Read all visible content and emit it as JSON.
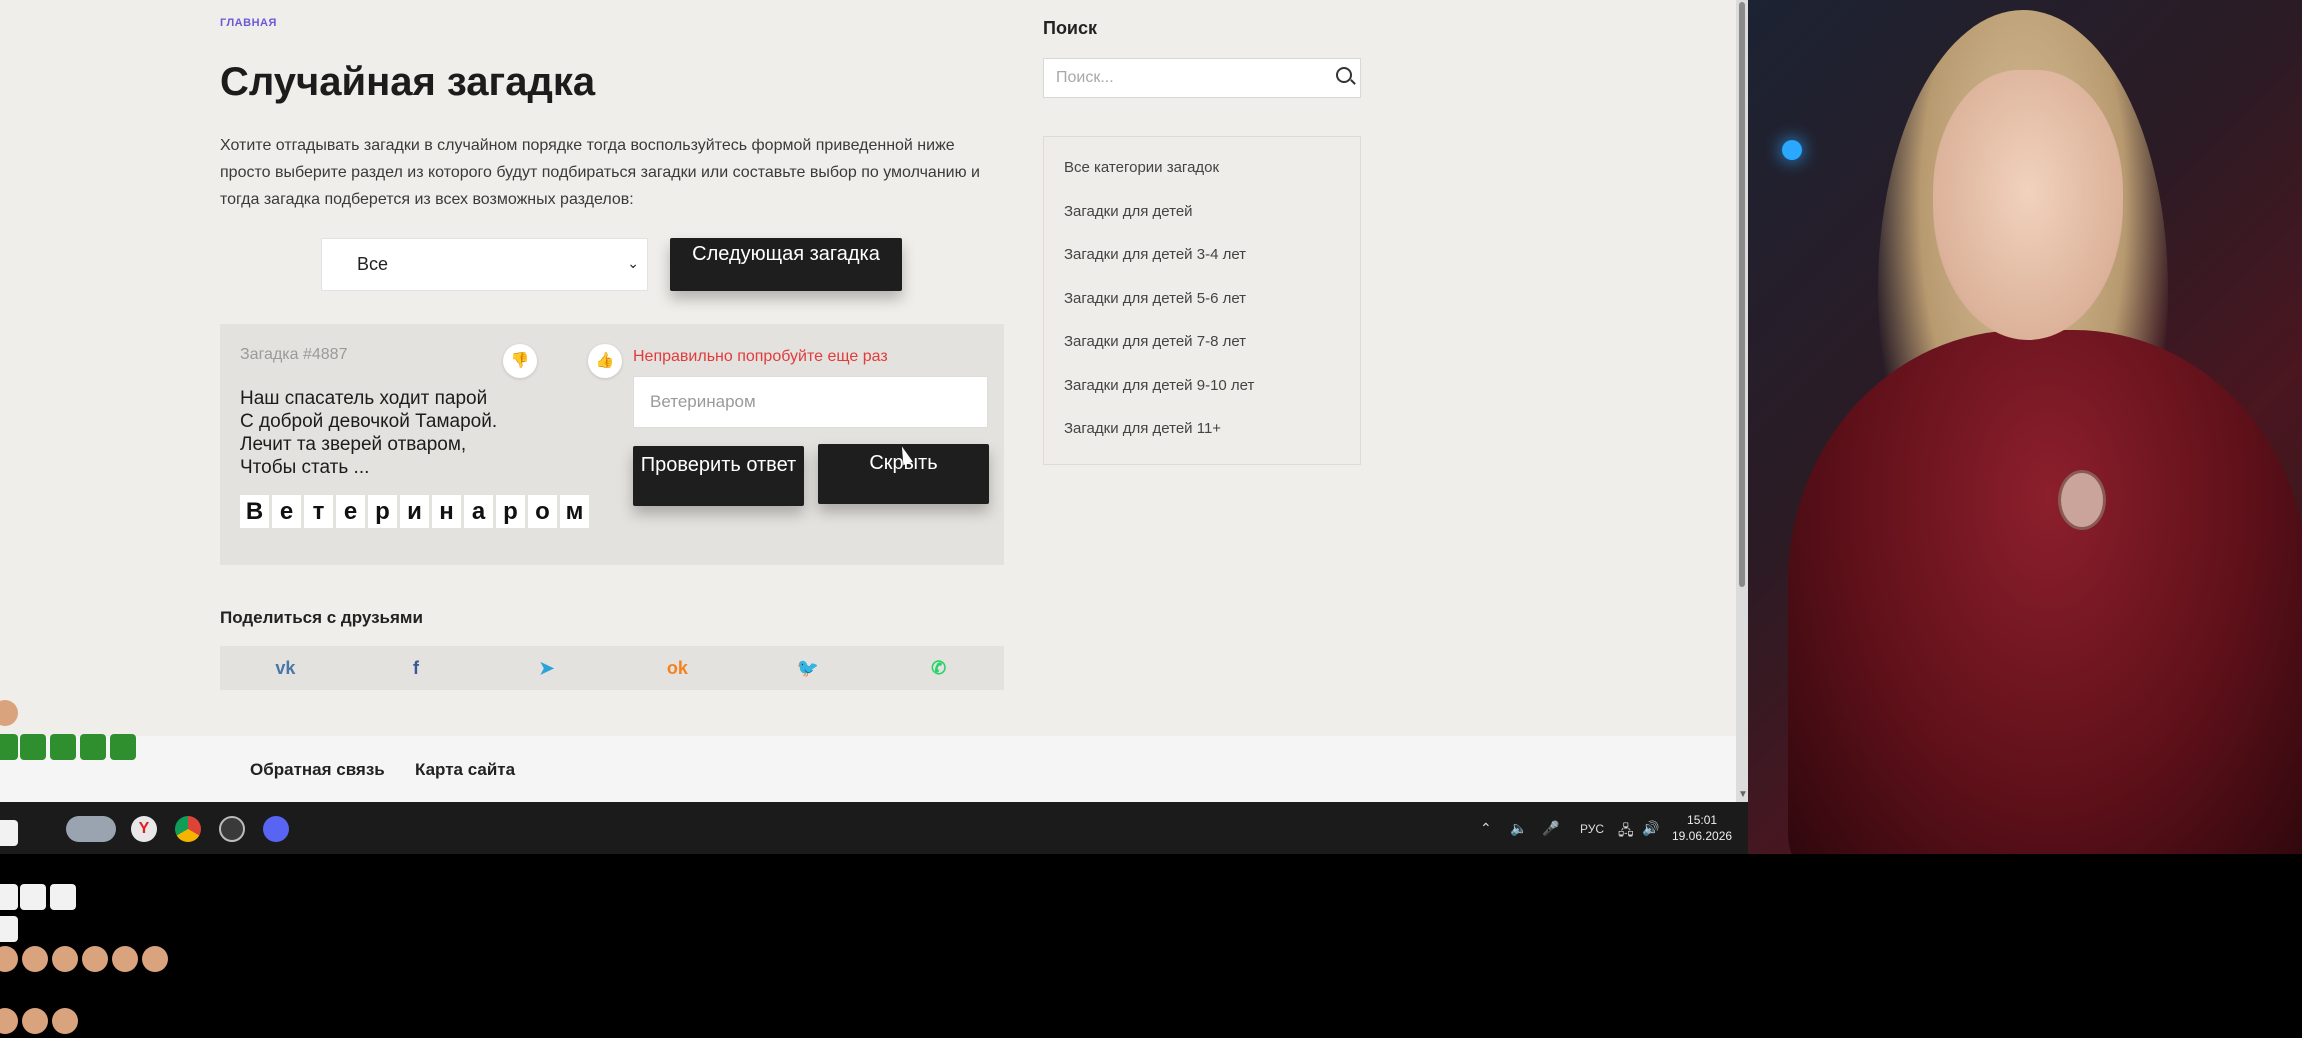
{
  "breadcrumb": "ГЛАВНАЯ",
  "page_title": "Случайная загадка",
  "intro": "Хотите отгадывать загадки в случайном порядке тогда воспользуйтесь формой приведенной ниже просто выберите раздел из которого будут подбираться загадки или составьте выбор по умолчанию и тогда загадка подберется из всех возможных разделов:",
  "filter": {
    "selected": "Все",
    "next_label": "Следующая загадка"
  },
  "riddle": {
    "number": "Загадка #4887",
    "error": "Неправильно попробуйте еще раз",
    "lines": [
      "Наш спасатель ходит парой",
      "С доброй девочкой Тамарой.",
      "Лечит та зверей отваром,",
      "Чтобы стать ..."
    ],
    "answer_value": "Ветеринаром",
    "check_label": "Проверить ответ",
    "hide_label": "Скрыть",
    "letters": [
      "В",
      "е",
      "т",
      "е",
      "р",
      "и",
      "н",
      "а",
      "р",
      "о",
      "м"
    ]
  },
  "share": {
    "title": "Поделиться с друзьями",
    "networks": [
      {
        "icon": "vk-icon",
        "glyph": "vk",
        "color": "#4a76a8"
      },
      {
        "icon": "facebook-icon",
        "glyph": "f",
        "color": "#3b5998"
      },
      {
        "icon": "telegram-icon",
        "glyph": "➤",
        "color": "#2aa3d9"
      },
      {
        "icon": "odnoklassniki-icon",
        "glyph": "ok",
        "color": "#f58220"
      },
      {
        "icon": "twitter-icon",
        "glyph": "🐦",
        "color": "#1da1f2"
      },
      {
        "icon": "whatsapp-icon",
        "glyph": "✆",
        "color": "#25d366"
      }
    ]
  },
  "sidebar": {
    "search_title": "Поиск",
    "search_placeholder": "Поиск...",
    "categories": [
      "Все категории загадок",
      "Загадки для детей",
      "Загадки для детей 3-4 лет",
      "Загадки для детей 5-6 лет",
      "Загадки для детей 7-8 лет",
      "Загадки для детей 9-10 лет",
      "Загадки для детей 11+"
    ]
  },
  "footer": {
    "feedback": "Обратная связь",
    "sitemap": "Карта сайта"
  },
  "taskbar": {
    "lang": "РУС",
    "time": "15:01",
    "date": "19.06.2026"
  }
}
